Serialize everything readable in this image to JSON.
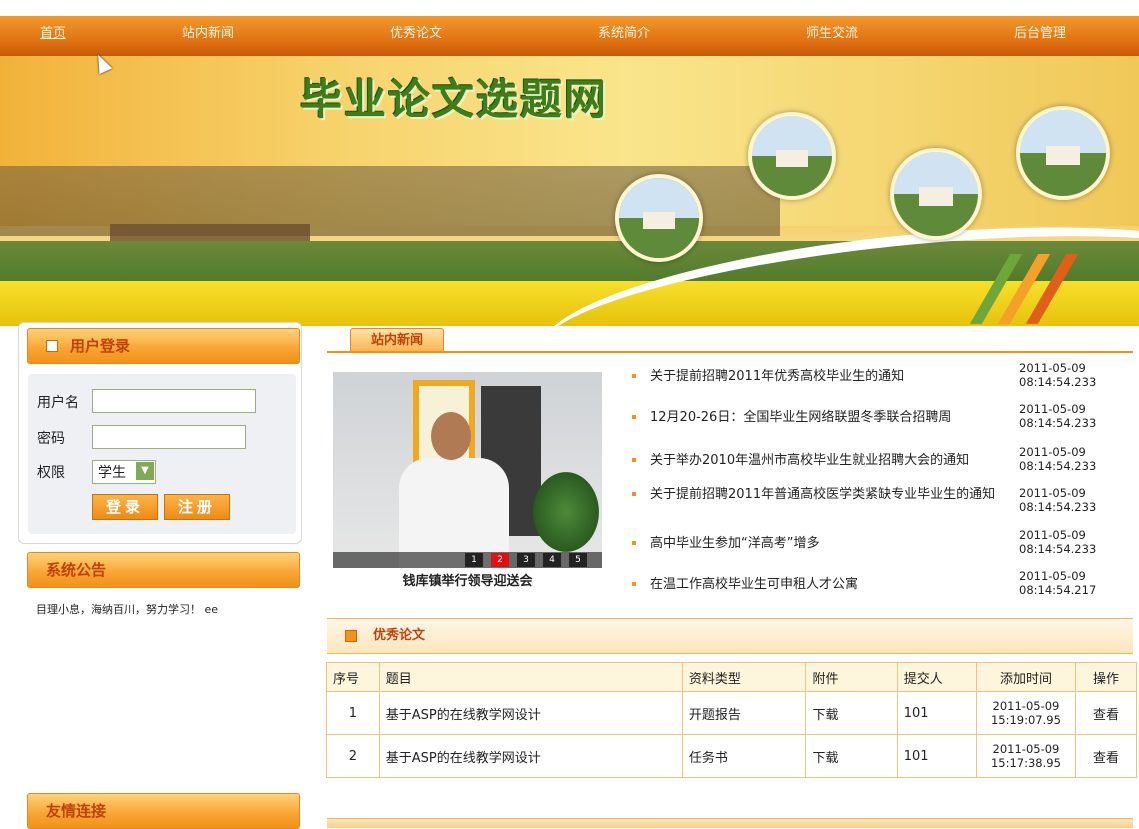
{
  "nav": {
    "items": [
      "首页",
      "站内新闻",
      "优秀论文",
      "系统简介",
      "师生交流",
      "后台管理"
    ],
    "active": "首页"
  },
  "banner": {
    "title": "毕业论文选题网"
  },
  "login": {
    "title": "用户登录",
    "username_label": "用户名",
    "username_value": "",
    "password_label": "密码",
    "password_value": "",
    "role_label": "权限",
    "role_value": "学生",
    "login_button": "登录",
    "register_button": "注册"
  },
  "announcement": {
    "title": "系统公告",
    "text": "目理小息，海纳百川，努力学习！ ee"
  },
  "links": {
    "title": "友情连接"
  },
  "news": {
    "tab": "站内新闻",
    "caption": "钱库镇举行领导迎送会",
    "pager": [
      "1",
      "2",
      "3",
      "4",
      "5"
    ],
    "pager_active": "2",
    "items": [
      {
        "title": "关于提前招聘2011年优秀高校毕业生的通知",
        "date": "2011-05-09",
        "time": "08:14:54.233"
      },
      {
        "title": "12月20-26日：全国毕业生网络联盟冬季联合招聘周",
        "date": "2011-05-09",
        "time": "08:14:54.233"
      },
      {
        "title": "关于举办2010年温州市高校毕业生就业招聘大会的通知",
        "date": "2011-05-09",
        "time": "08:14:54.233"
      },
      {
        "title": "关于提前招聘2011年普通高校医学类紧缺专业毕业生的通知",
        "date": "2011-05-09",
        "time": "08:14:54.233"
      },
      {
        "title": "高中毕业生参加“洋高考”增多",
        "date": "2011-05-09",
        "time": "08:14:54.233"
      },
      {
        "title": "在温工作高校毕业生可申租人才公寓",
        "date": "2011-05-09",
        "time": "08:14:54.217"
      }
    ]
  },
  "papers": {
    "title": "优秀论文",
    "columns": [
      "序号",
      "题目",
      "资料类型",
      "附件",
      "提交人",
      "添加时间",
      "操作"
    ],
    "rows": [
      {
        "no": "1",
        "title": "基于ASP的在线教学网设计",
        "type": "开题报告",
        "attachment": "下载",
        "submitter": "101",
        "date": "2011-05-09",
        "time": "15:19:07.95",
        "action": "查看"
      },
      {
        "no": "2",
        "title": "基于ASP的在线教学网设计",
        "type": "任务书",
        "attachment": "下载",
        "submitter": "101",
        "date": "2011-05-09",
        "time": "15:17:38.95",
        "action": "查看"
      }
    ]
  },
  "colors": {
    "accent": "#f29218",
    "title_red": "#c0420a",
    "banner_title": "#3f7d1a"
  }
}
